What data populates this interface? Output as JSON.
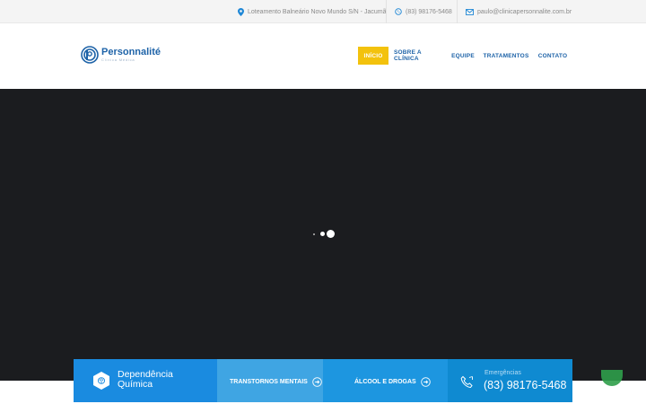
{
  "topbar": {
    "address": "Loteamento Balneário Novo Mundo S/N - Jacumã",
    "whatsapp": "(83) 98176-5468",
    "email": "paulo@clinicapersonnalite.com.br"
  },
  "brand": {
    "name": "Personnalité",
    "tagline": "Clínica Médica"
  },
  "nav": {
    "items": [
      {
        "label": "INÍCIO",
        "active": true
      },
      {
        "label": "SOBRE A CLÍNICA",
        "active": false
      },
      {
        "label": "EQUIPE",
        "active": false
      },
      {
        "label": "TRATAMENTOS",
        "active": false
      },
      {
        "label": "CONTATO",
        "active": false
      }
    ]
  },
  "features": {
    "primary_line1": "Dependência",
    "primary_line2": "Química",
    "link1": "TRANSTORNOS MENTAIS",
    "link2": "ÁLCOOL E DROGAS",
    "emergency_label": "Emergências",
    "emergency_phone": "(83) 98176-5468"
  },
  "colors": {
    "brand_blue": "#1e63a8",
    "accent_yellow": "#f3c20d",
    "hero_bg": "#1b1c1f",
    "feature_blue": "#1a8be0"
  }
}
